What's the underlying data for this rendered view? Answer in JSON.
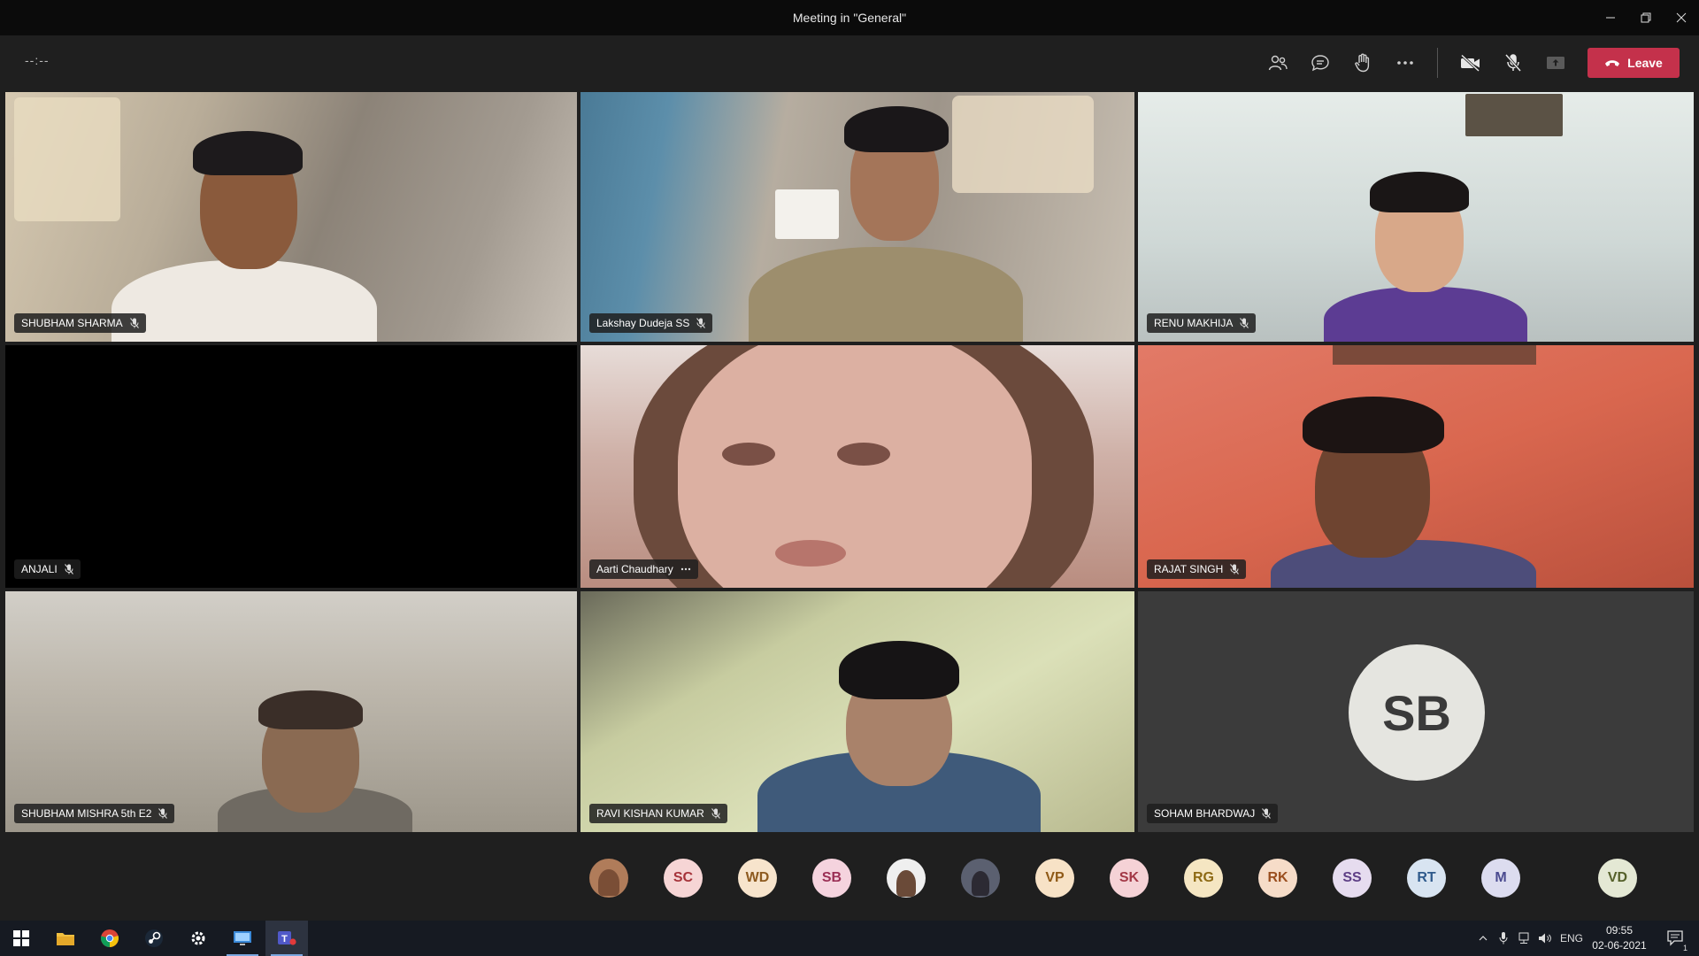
{
  "window": {
    "title": "Meeting in \"General\""
  },
  "toolbar": {
    "timer": "--:--",
    "leave_label": "Leave"
  },
  "participants": [
    {
      "name": "SHUBHAM SHARMA",
      "status": "muted"
    },
    {
      "name": "Lakshay Dudeja SS",
      "status": "muted"
    },
    {
      "name": "RENU MAKHIJA",
      "status": "muted"
    },
    {
      "name": "ANJALI",
      "status": "muted"
    },
    {
      "name": "Aarti Chaudhary",
      "status": "more"
    },
    {
      "name": "RAJAT SINGH",
      "status": "muted"
    },
    {
      "name": "SHUBHAM MISHRA 5th E2",
      "status": "muted"
    },
    {
      "name": "RAVI KISHAN KUMAR",
      "status": "muted"
    },
    {
      "name": "SOHAM BHARDWAJ",
      "status": "muted",
      "initials": "SB"
    }
  ],
  "attendee_strip": [
    {
      "initials": "",
      "photo": true,
      "bg": "#b07c5a"
    },
    {
      "initials": "SC",
      "bg": "#f6d5d5",
      "fg": "#a6333a"
    },
    {
      "initials": "WD",
      "bg": "#f7e4cc",
      "fg": "#8d5a1f"
    },
    {
      "initials": "SB",
      "bg": "#f5d3de",
      "fg": "#9b2f55"
    },
    {
      "initials": "",
      "photo": true,
      "bg": "#efefef"
    },
    {
      "initials": "",
      "photo": true,
      "bg": "#5b6070"
    },
    {
      "initials": "VP",
      "bg": "#f7e2c6",
      "fg": "#8f5a17"
    },
    {
      "initials": "SK",
      "bg": "#f5d2d6",
      "fg": "#a33846"
    },
    {
      "initials": "RG",
      "bg": "#f5e6c2",
      "fg": "#8d6a14"
    },
    {
      "initials": "RK",
      "bg": "#f6dcc8",
      "fg": "#9a4e1f"
    },
    {
      "initials": "SS",
      "bg": "#e6dcef",
      "fg": "#5e3f86"
    },
    {
      "initials": "RT",
      "bg": "#d8e4f1",
      "fg": "#2f5a8c"
    },
    {
      "initials": "M",
      "bg": "#dcdcef",
      "fg": "#4a4a8f"
    },
    {
      "initials": "VD",
      "bg": "#e4e8d4",
      "fg": "#55602a"
    }
  ],
  "taskbar": {
    "apps": [
      "start-icon",
      "file-explorer-icon",
      "chrome-icon",
      "steam-icon",
      "settings-icon",
      "remote-desktop-icon",
      "teams-icon"
    ],
    "language": "ENG",
    "time": "09:55",
    "date": "02-06-2021",
    "notification_count": "1"
  },
  "colors": {
    "leave": "#c4314b",
    "background": "#1f1f1f"
  }
}
